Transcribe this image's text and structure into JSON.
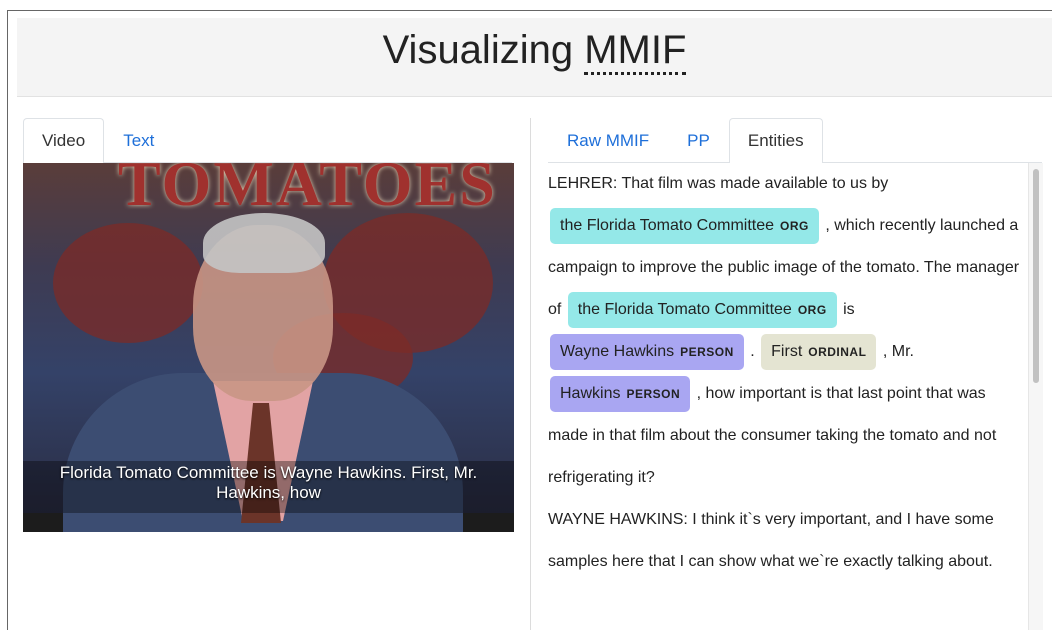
{
  "header": {
    "title_prefix": "Visualizing ",
    "title_abbr": "MMIF"
  },
  "left_tabs": [
    {
      "label": "Video",
      "active": true
    },
    {
      "label": "Text",
      "active": false
    }
  ],
  "right_tabs": [
    {
      "label": "Raw MMIF",
      "active": false
    },
    {
      "label": "PP",
      "active": false
    },
    {
      "label": "Entities",
      "active": true
    }
  ],
  "video": {
    "sign_text": "TOMATOES",
    "caption_line1": "Florida Tomato Committee is Wayne Hawkins. First, Mr.",
    "caption_line2": "Hawkins, how"
  },
  "entities": {
    "t1": "LEHRER: That film was made available to us by",
    "e1_text": "the Florida Tomato Committee",
    "e1_label": "ORG",
    "t2": ", which recently launched a campaign to improve the public image of the tomato. The manager of",
    "e2_text": "the Florida Tomato Committee",
    "e2_label": "ORG",
    "t3": "is",
    "e3_text": "Wayne Hawkins",
    "e3_label": "PERSON",
    "t4": ".",
    "e4_text": "First",
    "e4_label": "ORDINAL",
    "t5": ", Mr.",
    "e5_text": "Hawkins",
    "e5_label": "PERSON",
    "t6": ", how important is that last point that was made in that film about the consumer taking the tomato and not refrigerating it?",
    "p2": "WAYNE HAWKINS: I think it`s very important, and I have some samples here that I can show what we`re exactly talking about."
  },
  "colors": {
    "org": "#94e8e8",
    "person": "#a9a6f2",
    "ordinal": "#e4e4d2",
    "link": "#1e6fd9"
  }
}
